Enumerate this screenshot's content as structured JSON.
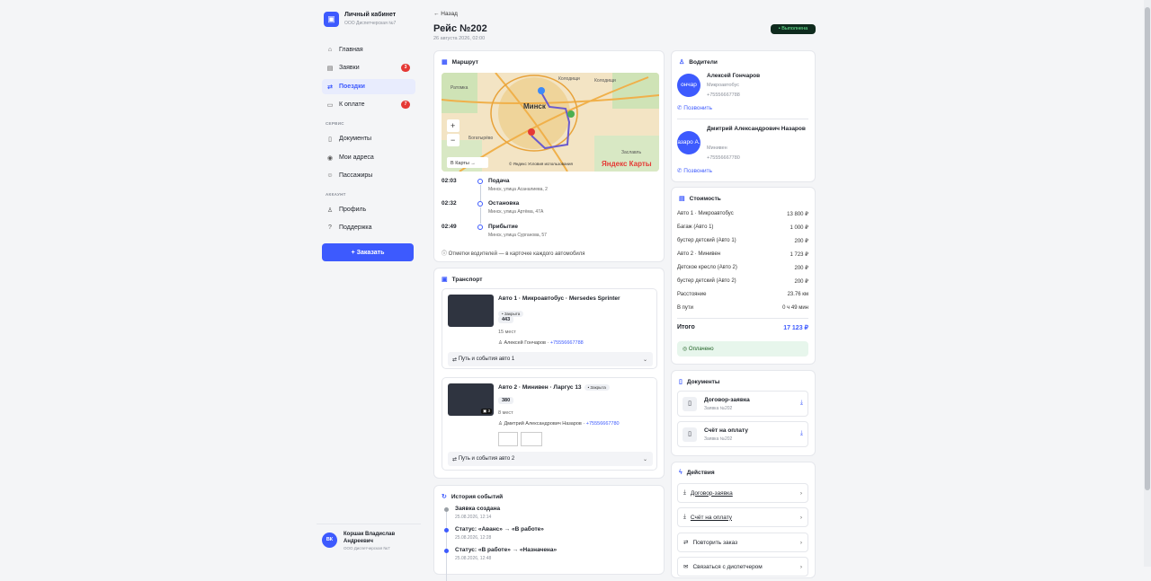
{
  "sidebar": {
    "brand_title": "Личный кабинет",
    "brand_sub": "ООО Диспетчерская №7",
    "nav": [
      {
        "label": "Главная",
        "icon": "home-icon"
      },
      {
        "label": "Заявки",
        "icon": "clipboard-icon",
        "badge": "3"
      },
      {
        "label": "Поездки",
        "icon": "route-icon"
      },
      {
        "label": "К оплате",
        "icon": "wallet-icon",
        "badge": "7"
      }
    ],
    "section_service": "СЕРВИС",
    "service": [
      {
        "label": "Документы",
        "icon": "document-icon"
      },
      {
        "label": "Мои адреса",
        "icon": "location-icon"
      },
      {
        "label": "Пассажиры",
        "icon": "users-icon"
      }
    ],
    "section_account": "АККАУНТ",
    "account": [
      {
        "label": "Профиль",
        "icon": "user-icon"
      },
      {
        "label": "Поддержка",
        "icon": "help-icon"
      }
    ],
    "order_button": "+ Заказать",
    "user": {
      "initials": "ВК",
      "name": "Коршак Владислав Андреевич",
      "org": "ООО Диспетчерская №7"
    }
  },
  "trip": {
    "back": "← Назад",
    "title": "Рейс №202",
    "date": "26 августа 2026, 02:00",
    "status": "• Выполнена"
  },
  "route": {
    "header": "Маршрут",
    "map": {
      "city": "Минск",
      "labels": [
        "Ратомка",
        "Колодищи",
        "Богатырёво",
        "Колодищи",
        "Заславль"
      ],
      "yandex_link": "В Карты →",
      "copyright": "© Яндекс Условия использования",
      "brand": "Яндекс Карты"
    },
    "stops": [
      {
        "time": "02:03",
        "title": "Подача",
        "addr": "Минск, улица Асаналиева, 2"
      },
      {
        "time": "02:32",
        "title": "Остановка",
        "addr": "Минск, улица Артёма, 47А"
      },
      {
        "time": "02:49",
        "title": "Прибытие",
        "addr": "Минск, улица Сурганова, 57"
      }
    ],
    "note": "ⓘ Отметки водителей — в карточке каждого автомобиля"
  },
  "transport": {
    "header": "Транспорт",
    "vehicles": [
      {
        "title": "Авто 1 · Микроавтобус · Mersedes Sprinter",
        "chip": "• Закрыта",
        "plate": "443",
        "seats": "15 мест",
        "driver": "Алексей Гончаров ·",
        "phone": "+75556667788",
        "path": "Путь и события авто 1"
      },
      {
        "title": "Авто 2 · Минивен · Ларгус 13",
        "chip": "• Закрыта",
        "plate": "380",
        "seats": "8 мест",
        "driver": "Дмитрий Александрович Назаров ·",
        "phone": "+75556667780",
        "path": "Путь и события авто 2",
        "photos": "3"
      }
    ]
  },
  "history": {
    "header": "История событий",
    "events": [
      {
        "title": "Заявка создана",
        "date": "25.08.2026, 12:14",
        "color": "#9aa0a6"
      },
      {
        "title": "Статус: «Аванс» → «В работе»",
        "date": "25.08.2026, 12:28",
        "color": "#3d5afe"
      },
      {
        "title": "Статус: «В работе» → «Назначена»",
        "date": "25.08.2026, 12:48",
        "color": "#3d5afe"
      }
    ]
  },
  "drivers": {
    "header": "Водители",
    "list": [
      {
        "avatar": "ончар",
        "name": "Алексей Гончаров",
        "type": "Микроавтобус",
        "phone": "+75556667788",
        "call": "Позвонить"
      },
      {
        "avatar": "азаро\nА.",
        "name": "Дмитрий Александрович Назаров",
        "type": "Минивен",
        "phone": "+75556667780",
        "call": "Позвонить"
      }
    ]
  },
  "cost": {
    "header": "Стоимость",
    "rows": [
      {
        "label": "Авто 1 · Микроавтобус",
        "value": "13 800 ₽"
      },
      {
        "label": "Багаж (Авто 1)",
        "value": "1 000 ₽"
      },
      {
        "label": "бустер детский (Авто 1)",
        "value": "200 ₽"
      },
      {
        "label": "Авто 2 · Минивен",
        "value": "1 723 ₽"
      },
      {
        "label": "Детское кресло (Авто 2)",
        "value": "200 ₽"
      },
      {
        "label": "бустер детский (Авто 2)",
        "value": "200 ₽"
      },
      {
        "label": "Расстояние",
        "value": "23.76 км"
      },
      {
        "label": "В пути",
        "value": "0 ч 49 мин"
      }
    ],
    "total_label": "Итого",
    "total_value": "17 123 ₽",
    "paid": "Оплачено"
  },
  "documents": {
    "header": "Документы",
    "items": [
      {
        "title": "Договор-заявка",
        "sub": "Заявка №202"
      },
      {
        "title": "Счёт на оплату",
        "sub": "Заявка №202"
      }
    ]
  },
  "actions": {
    "header": "Действия",
    "items": [
      {
        "label": "Договор-заявка",
        "icon": "download-icon"
      },
      {
        "label": "Счёт на оплату",
        "icon": "download-icon"
      },
      {
        "label": "Повторить заказ",
        "icon": "repeat-icon"
      },
      {
        "label": "Связаться с диспетчером",
        "icon": "chat-icon"
      }
    ]
  }
}
